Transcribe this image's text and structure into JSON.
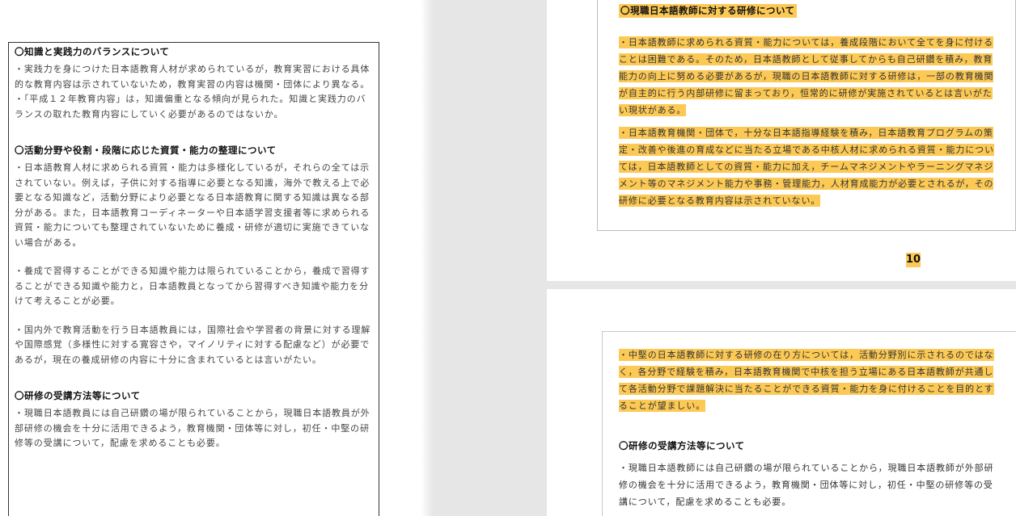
{
  "left_page": {
    "sections": [
      {
        "title": "〇知識と実践力のバランスについて",
        "paragraphs": [
          "・実践力を身につけた日本語教育人材が求められているが，教育実習における具体的な教育内容は示されていないため，教育実習の内容は機関・団体により異なる。",
          "・「平成１２年教育内容」は，知識偏重となる傾向が見られた。知識と実践力のバランスの取れた教育内容にしていく必要があるのではないか。"
        ]
      },
      {
        "title": "〇活動分野や役割・段階に応じた資質・能力の整理について",
        "paragraphs": [
          "・日本語教育人材に求められる資質・能力は多様化しているが，それらの全ては示されていない。例えば，子供に対する指導に必要となる知識，海外で教える上で必要となる知識など，活動分野により必要となる日本語教育に関する知識は異なる部分がある。また，日本語教育コーディネーターや日本語学習支援者等に求められる資質・能力についても整理されていないために養成・研修が適切に実施できていない場合がある。",
          "・養成で習得することができる知識や能力は限られていることから，養成で習得することができる知識や能力と，日本語教員となってから習得すべき知識や能力を分けて考えることが必要。",
          "・国内外で教育活動を行う日本語教員には，国際社会や学習者の背景に対する理解や国際感覚（多様性に対する寛容さや，マイノリティに対する配慮など）が必要であるが，現在の養成研修の内容に十分に含まれているとは言いがたい。"
        ]
      },
      {
        "title": "〇研修の受講方法等について",
        "paragraphs": [
          "・現職日本語教員には自己研鑽の場が限られていることから，現職日本語教員が外部研修の機会を十分に活用できるよう，教育機関・団体等に対し，初任・中堅の研修等の受講について，配慮を求めることも必要。"
        ]
      }
    ]
  },
  "right_pages": {
    "page1": {
      "title": "〇現職日本語教師に対する研修について",
      "paragraphs": [
        "・日本語教師に求められる資質・能力については，養成段階において全てを身に付けることは困難である。そのため，日本語教師として従事してからも自己研鑽を積み，教育能力の向上に努める必要があるが，現職の日本語教師に対する研修は，一部の教育機関が自主的に行う内部研修に留まっており，恒常的に研修が実施されているとは言いがたい現状がある。",
        "・日本語教育機関・団体で，十分な日本語指導経験を積み，日本語教育プログラムの策定・改善や後進の育成などに当たる立場である中核人材に求められる資質・能力については，日本語教師としての資質・能力に加え，チームマネジメントやラーニングマネジメント等のマネジメント能力や事務・管理能力，人材育成能力が必要とされるが，その研修に必要となる教育内容は示されていない。"
      ],
      "page_number": "10"
    },
    "page2": {
      "highlighted_paragraph": "・中堅の日本語教師に対する研修の在り方については，活動分野別に示されるのではなく，各分野で経験を積み，日本語教育機関で中核を担う立場にある日本語教師が共通して各活動分野で課題解決に当たることができる資質・能力を身に付けることを目的とすることが望ましい。",
      "title": "〇研修の受講方法等について",
      "paragraph": "・現職日本語教師には自己研鑽の場が限られていることから，現職日本語教師が外部研修の機会を十分に活用できるよう，教育機関・団体等に対し，初任・中堅の研修等の受講について，配慮を求めることも必要。"
    }
  },
  "colors": {
    "highlight": "#fcc955",
    "viewer_bg": "#e6e6e6",
    "page_border": "#333333"
  }
}
